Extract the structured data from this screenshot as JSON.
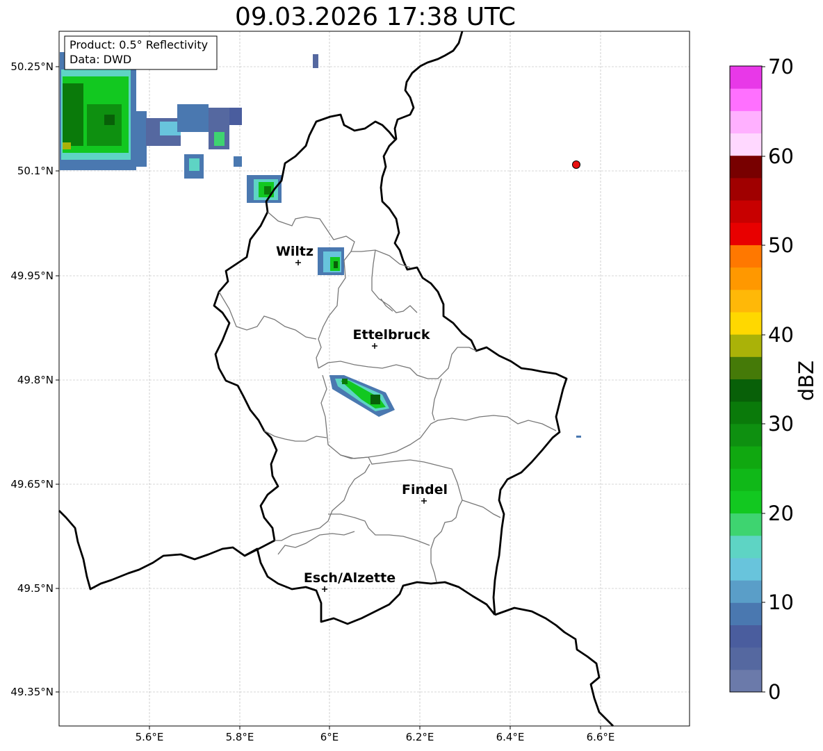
{
  "title": "09.03.2026 17:38 UTC",
  "info_box": {
    "line1": "Product: 0.5° Reflectivity",
    "line2": "Data: DWD"
  },
  "axes": {
    "lon_ticks": [
      "5.6°E",
      "5.8°E",
      "6°E",
      "6.2°E",
      "6.4°E",
      "6.6°E"
    ],
    "lat_ticks": [
      "50.25°N",
      "50.1°N",
      "49.95°N",
      "49.8°N",
      "49.65°N",
      "49.5°N",
      "49.35°N"
    ]
  },
  "cities": [
    {
      "name": "Wiltz"
    },
    {
      "name": "Ettelbruck"
    },
    {
      "name": "Findel"
    },
    {
      "name": "Esch/Alzette"
    }
  ],
  "colorbar": {
    "label": "dBZ",
    "ticks": [
      "70",
      "60",
      "50",
      "40",
      "30",
      "20",
      "10",
      "0"
    ],
    "colors": [
      "#6b7aaa",
      "#5568a0",
      "#4a5d9e",
      "#4a78b0",
      "#5a9ec8",
      "#68c4dc",
      "#5ed4c4",
      "#3ed470",
      "#12c820",
      "#10b818",
      "#10a810",
      "#0e9010",
      "#0a7a0a",
      "#086008",
      "#457a08",
      "#aab208",
      "#ffd800",
      "#ffb808",
      "#ff9800",
      "#ff7800",
      "#e80000",
      "#c80000",
      "#a00000",
      "#780000",
      "#ffd8ff",
      "#ffb0ff",
      "#ff70ff",
      "#e838e8"
    ]
  }
}
